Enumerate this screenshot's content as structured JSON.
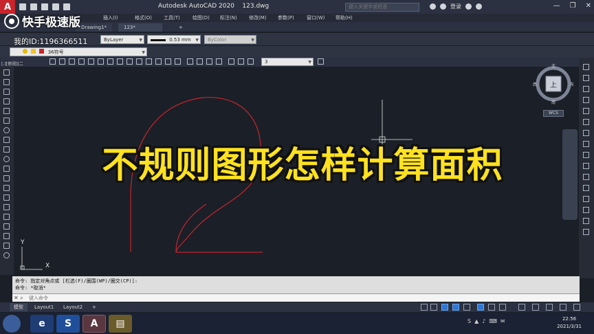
{
  "titlebar": {
    "app_logo": "A",
    "app_name": "Autodesk AutoCAD 2020",
    "file_name": "123.dwg",
    "search_placeholder": "键入关键字或短语",
    "login_label": "登录",
    "minimize": "—",
    "restore": "❐",
    "close": "✕"
  },
  "menu": {
    "items": [
      "插入(I)",
      "格式(O)",
      "工具(T)",
      "绘图(D)",
      "标注(N)",
      "修改(M)",
      "参数(P)",
      "窗口(W)",
      "帮助(H)"
    ]
  },
  "watermark": {
    "brand": "快手极速版",
    "id_label": "我的ID:1196366511"
  },
  "file_tabs": {
    "tab1": "Drawing1*",
    "tab2": "123*",
    "add": "+"
  },
  "properties": {
    "color": "ByLayer",
    "lineweight": "0.53 mm",
    "linetype": "ByColor",
    "layer": "36符号",
    "dim_value": "3"
  },
  "view_label": "[-][俯视][二",
  "viewcube": {
    "north": "北",
    "south": "南",
    "east": "东",
    "west": "西",
    "face": "上",
    "wcs": "WCS"
  },
  "ucs": {
    "x_label": "X",
    "y_label": "Y"
  },
  "caption": "不规则图形怎样计算面积",
  "command": {
    "line1": "命令: 指定对角点或 [栏选(F)/圈围(WP)/圈交(CP)]:",
    "line2": "命令: *取消*",
    "placeholder": "键入命令"
  },
  "layout_tabs": {
    "model": "模型",
    "layout1": "Layout1",
    "layout2": "Layout2",
    "add": "+"
  },
  "clock": {
    "time": "22:56",
    "date": "2021/3/31"
  },
  "colors": {
    "accent_red": "#c8252c",
    "caption_yellow": "#ffe21f",
    "curve_red": "#c8252c"
  }
}
